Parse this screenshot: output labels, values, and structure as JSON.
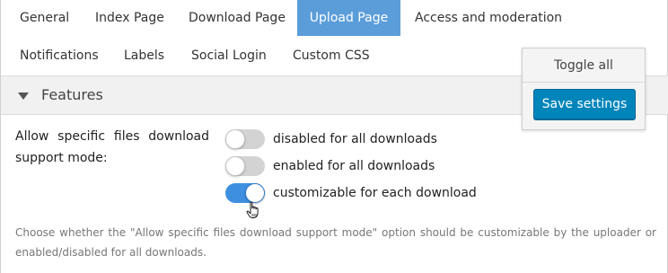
{
  "tabs": {
    "row1": [
      {
        "label": "General",
        "active": false
      },
      {
        "label": "Index Page",
        "active": false
      },
      {
        "label": "Download Page",
        "active": false
      },
      {
        "label": "Upload Page",
        "active": true
      },
      {
        "label": "Access and moderation",
        "active": false
      }
    ],
    "row2": [
      {
        "label": "Notifications",
        "active": false
      },
      {
        "label": "Labels",
        "active": false
      },
      {
        "label": "Social Login",
        "active": false
      },
      {
        "label": "Custom CSS",
        "active": false
      }
    ]
  },
  "section": {
    "title": "Features",
    "icon": "caret-down-icon"
  },
  "panel": {
    "toggle_all": "Toggle all",
    "save_settings": "Save settings"
  },
  "setting": {
    "label": "Allow specific files download support mode:",
    "options": [
      {
        "label": "disabled for all downloads",
        "checked": false
      },
      {
        "label": "enabled for all downloads",
        "checked": false
      },
      {
        "label": "customizable for each download",
        "checked": true
      }
    ],
    "description": "Choose whether the \"Allow specific files download support mode\" option should be customizable by the uploader or enabled/disabled for all downloads."
  },
  "colors": {
    "active_tab": "#5b9dd9",
    "toggle_on": "#3f8fe0",
    "toggle_off": "#d3d3d3",
    "primary_button": "#0085ba"
  }
}
